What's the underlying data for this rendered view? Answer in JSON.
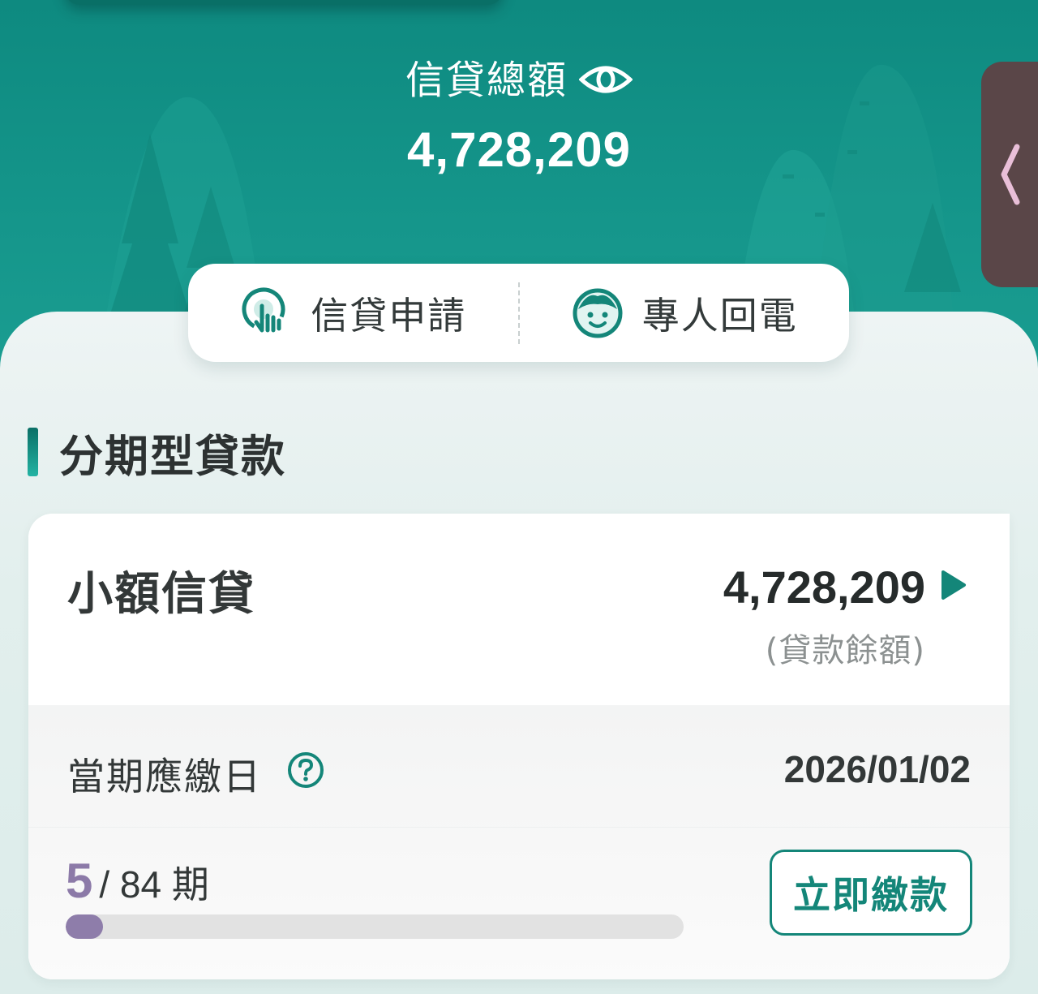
{
  "header": {
    "total_label": "信貸總額",
    "total_amount": "4,728,209",
    "visibility_icon": "eye-icon",
    "side_tab_icon": "chevron-left-icon"
  },
  "quick_actions": [
    {
      "label": "信貸申請",
      "icon": "tap-hand-icon"
    },
    {
      "label": "專人回電",
      "icon": "agent-face-icon"
    }
  ],
  "section": {
    "title": "分期型貸款"
  },
  "loan_card": {
    "name": "小額信貸",
    "balance": "4,728,209",
    "balance_note": "(貸款餘額)",
    "detail_icon": "play-icon",
    "due_label": "當期應繳日",
    "help_icon": "question-circle-icon",
    "due_date": "2026/01/02",
    "current_period": "5",
    "total_periods_text": "/ 84 期",
    "progress_fraction": 0.06,
    "pay_button": "立即繳款"
  },
  "colors": {
    "brand": "#148679",
    "hero_bg": "#15968b",
    "progress": "#8e7daa",
    "side_tab": "#5a4648"
  }
}
